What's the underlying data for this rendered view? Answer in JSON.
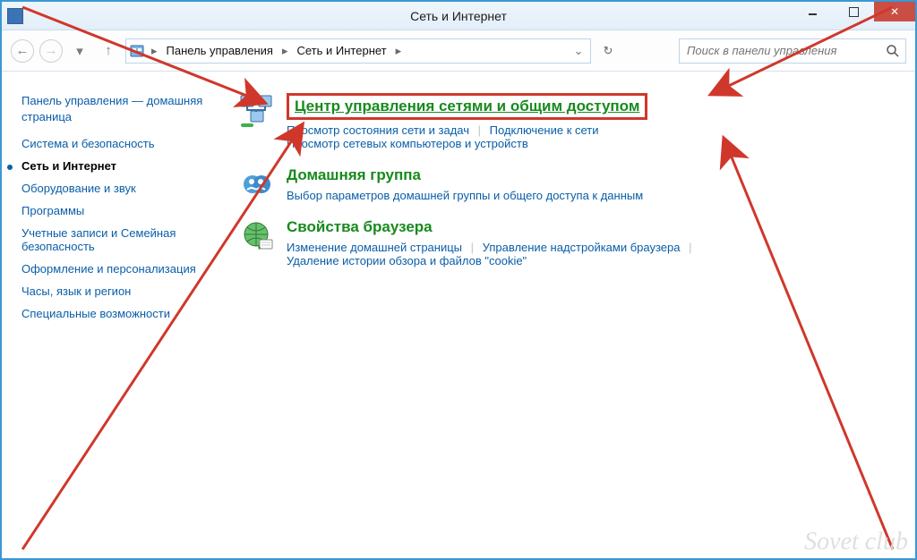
{
  "window": {
    "title": "Сеть и Интернет",
    "controls": {
      "minimize": "min",
      "maximize": "max",
      "close": "close"
    }
  },
  "navbar": {
    "breadcrumbs": [
      "Панель управления",
      "Сеть и Интернет"
    ],
    "search_placeholder": "Поиск в панели управления"
  },
  "sidebar": {
    "home_label": "Панель управления — домашняя страница",
    "categories": [
      {
        "id": "system",
        "label": "Система и безопасность"
      },
      {
        "id": "network",
        "label": "Сеть и Интернет",
        "active": true
      },
      {
        "id": "hardware",
        "label": "Оборудование и звук"
      },
      {
        "id": "programs",
        "label": "Программы"
      },
      {
        "id": "users",
        "label": "Учетные записи и Семейная безопасность"
      },
      {
        "id": "appearance",
        "label": "Оформление и персонализация"
      },
      {
        "id": "clock",
        "label": "Часы, язык и регион"
      },
      {
        "id": "access",
        "label": "Специальные возможности"
      }
    ]
  },
  "sections": [
    {
      "id": "network-center",
      "title": "Центр управления сетями и общим доступом",
      "highlighted": true,
      "links": [
        "Просмотр состояния сети и задач",
        "Подключение к сети",
        "Просмотр сетевых компьютеров и устройств"
      ]
    },
    {
      "id": "homegroup",
      "title": "Домашняя группа",
      "links": [
        "Выбор параметров домашней группы и общего доступа к данным"
      ]
    },
    {
      "id": "internet-options",
      "title": "Свойства браузера",
      "links": [
        "Изменение домашней страницы",
        "Управление надстройками браузера",
        "Удаление истории обзора и файлов \"cookie\""
      ]
    }
  ],
  "watermark": "Sovet club",
  "annotation": {
    "color": "#d0372b"
  }
}
